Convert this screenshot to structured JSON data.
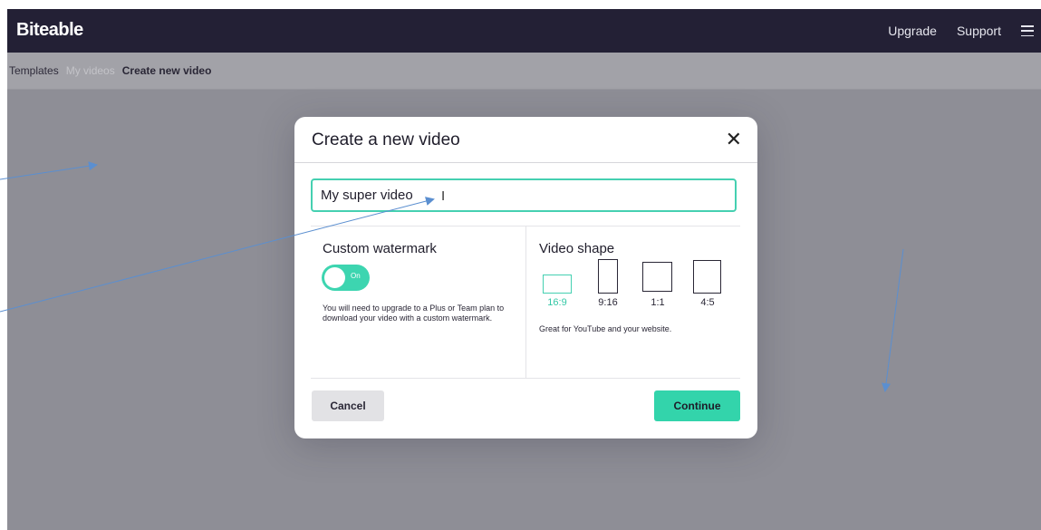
{
  "app": {
    "logo": "Biteable"
  },
  "topnav": {
    "upgrade": "Upgrade",
    "support": "Support",
    "menu_icon": "hamburger-menu-icon"
  },
  "breadcrumb": {
    "templates": "Templates",
    "my_videos": "My videos",
    "current": "Create new video"
  },
  "modal": {
    "title": "Create a new video",
    "close_icon": "close-icon",
    "name_value": "My super video",
    "watermark": {
      "title": "Custom watermark",
      "toggle_label": "On",
      "toggle_state": true,
      "description": "You will need to upgrade to a Plus or Team plan to download your video with a custom watermark."
    },
    "video_shape": {
      "title": "Video shape",
      "options": [
        {
          "label": "16:9",
          "selected": true
        },
        {
          "label": "9:16",
          "selected": false
        },
        {
          "label": "1:1",
          "selected": false
        },
        {
          "label": "4:5",
          "selected": false
        }
      ],
      "description": "Great for YouTube and your website."
    },
    "cancel_label": "Cancel",
    "continue_label": "Continue"
  },
  "colors": {
    "accent": "#33d4ab",
    "topbar": "#232035",
    "overlay": "#8e8e96",
    "annotation_arrow": "#5b8fd0"
  }
}
